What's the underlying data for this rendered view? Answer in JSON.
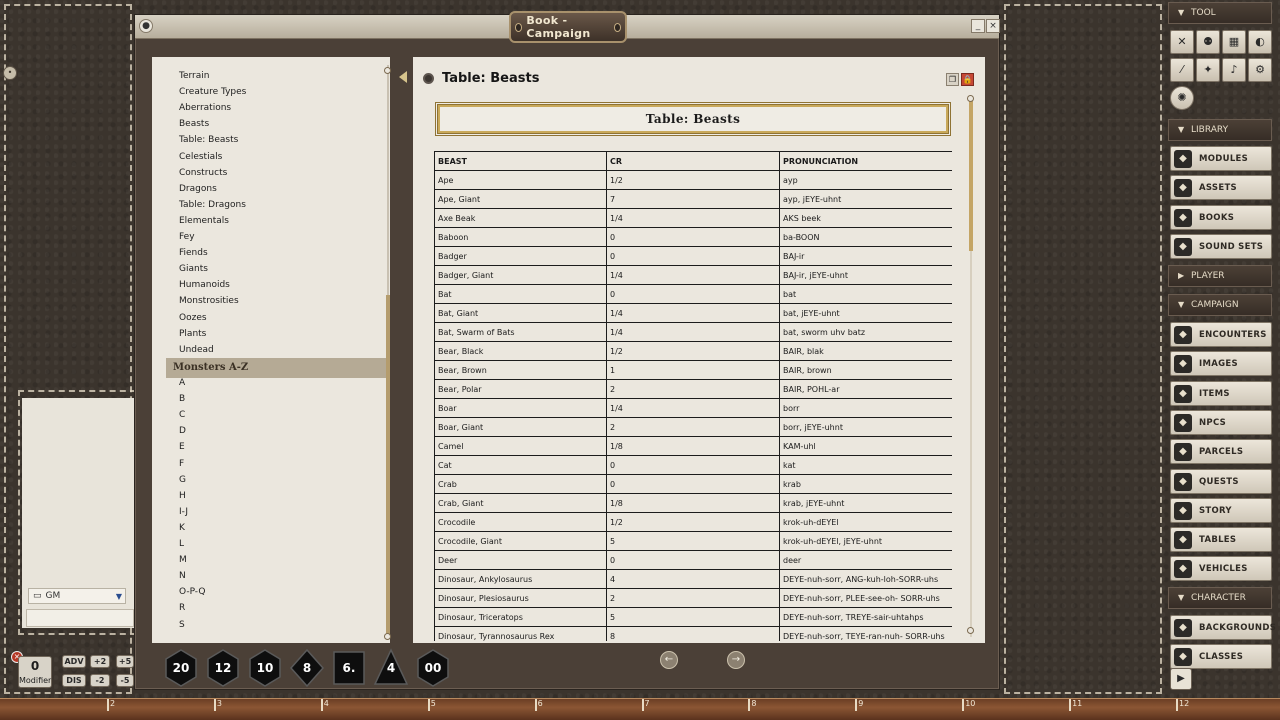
{
  "window": {
    "title": "Book - Campaign",
    "minimize": "_",
    "close": "×"
  },
  "nav": {
    "items": [
      "Terrain",
      "Creature Types",
      "Aberrations",
      "Beasts",
      "Table: Beasts",
      "Celestials",
      "Constructs",
      "Dragons",
      "Table: Dragons",
      "Elementals",
      "Fey",
      "Fiends",
      "Giants",
      "Humanoids",
      "Monstrosities",
      "Oozes",
      "Plants",
      "Undead"
    ],
    "group": "Monsters A-Z",
    "letters": [
      "A",
      "B",
      "C",
      "D",
      "E",
      "F",
      "G",
      "H",
      "I-J",
      "K",
      "L",
      "M",
      "N",
      "O-P-Q",
      "R",
      "S"
    ]
  },
  "content": {
    "title": "Table: Beasts",
    "banner": "Table: Beasts",
    "columns": [
      "BEAST",
      "CR",
      "PRONUNCIATION"
    ],
    "rows": [
      [
        "Ape",
        "1/2",
        "ayp"
      ],
      [
        "Ape, Giant",
        "7",
        "ayp, jEYE-uhnt"
      ],
      [
        "Axe Beak",
        "1/4",
        "AKS beek"
      ],
      [
        "Baboon",
        "0",
        "ba-BOON"
      ],
      [
        "Badger",
        "0",
        "BAJ-ir"
      ],
      [
        "Badger, Giant",
        "1/4",
        "BAJ-ir, jEYE-uhnt"
      ],
      [
        "Bat",
        "0",
        "bat"
      ],
      [
        "Bat, Giant",
        "1/4",
        "bat, jEYE-uhnt"
      ],
      [
        "Bat, Swarm of Bats",
        "1/4",
        "bat, sworm uhv batz"
      ],
      [
        "Bear, Black",
        "1/2",
        "BAIR, blak"
      ],
      [
        "Bear, Brown",
        "1",
        "BAIR, brown"
      ],
      [
        "Bear, Polar",
        "2",
        "BAIR, POHL-ar"
      ],
      [
        "Boar",
        "1/4",
        "borr"
      ],
      [
        "Boar, Giant",
        "2",
        "borr, jEYE-uhnt"
      ],
      [
        "Camel",
        "1/8",
        "KAM-uhl"
      ],
      [
        "Cat",
        "0",
        "kat"
      ],
      [
        "Crab",
        "0",
        "krab"
      ],
      [
        "Crab, Giant",
        "1/8",
        "krab, jEYE-uhnt"
      ],
      [
        "Crocodile",
        "1/2",
        "krok-uh-dEYEl"
      ],
      [
        "Crocodile, Giant",
        "5",
        "krok-uh-dEYEl, jEYE-uhnt"
      ],
      [
        "Deer",
        "0",
        "deer"
      ],
      [
        "Dinosaur, Ankylosaurus",
        "4",
        "DEYE-nuh-sorr, ANG-kuh-loh-SORR-uhs"
      ],
      [
        "Dinosaur, Plesiosaurus",
        "2",
        "DEYE-nuh-sorr, PLEE-see-oh- SORR-uhs"
      ],
      [
        "Dinosaur, Triceratops",
        "5",
        "DEYE-nuh-sorr, TREYE-sair-uhtahps"
      ],
      [
        "Dinosaur, Tyrannosaurus Rex",
        "8",
        "DEYE-nuh-sorr, TEYE-ran-nuh- SORR-uhs"
      ]
    ]
  },
  "chat": {
    "identity": "GM"
  },
  "modifier": {
    "value": "0",
    "label": "Modifier",
    "adv": "ADV",
    "dis": "DIS",
    "plus2": "+2",
    "minus2": "-2",
    "plus5": "+5",
    "minus5": "-5"
  },
  "dice": [
    "20",
    "12",
    "10",
    "8",
    "6.",
    "4",
    "00"
  ],
  "sidebar": {
    "tool": "TOOL",
    "library": "LIBRARY",
    "library_items": [
      "MODULES",
      "ASSETS",
      "BOOKS",
      "SOUND SETS"
    ],
    "player": "PLAYER",
    "campaign": "CAMPAIGN",
    "campaign_items": [
      "ENCOUNTERS",
      "IMAGES",
      "ITEMS",
      "NPCS",
      "PARCELS",
      "QUESTS",
      "STORY",
      "TABLES",
      "VEHICLES"
    ],
    "character": "CHARACTER",
    "character_items": [
      "BACKGROUNDS",
      "CLASSES"
    ]
  },
  "ruler": [
    "2",
    "3",
    "4",
    "5",
    "6",
    "7",
    "8",
    "9",
    "10",
    "11",
    "12"
  ]
}
